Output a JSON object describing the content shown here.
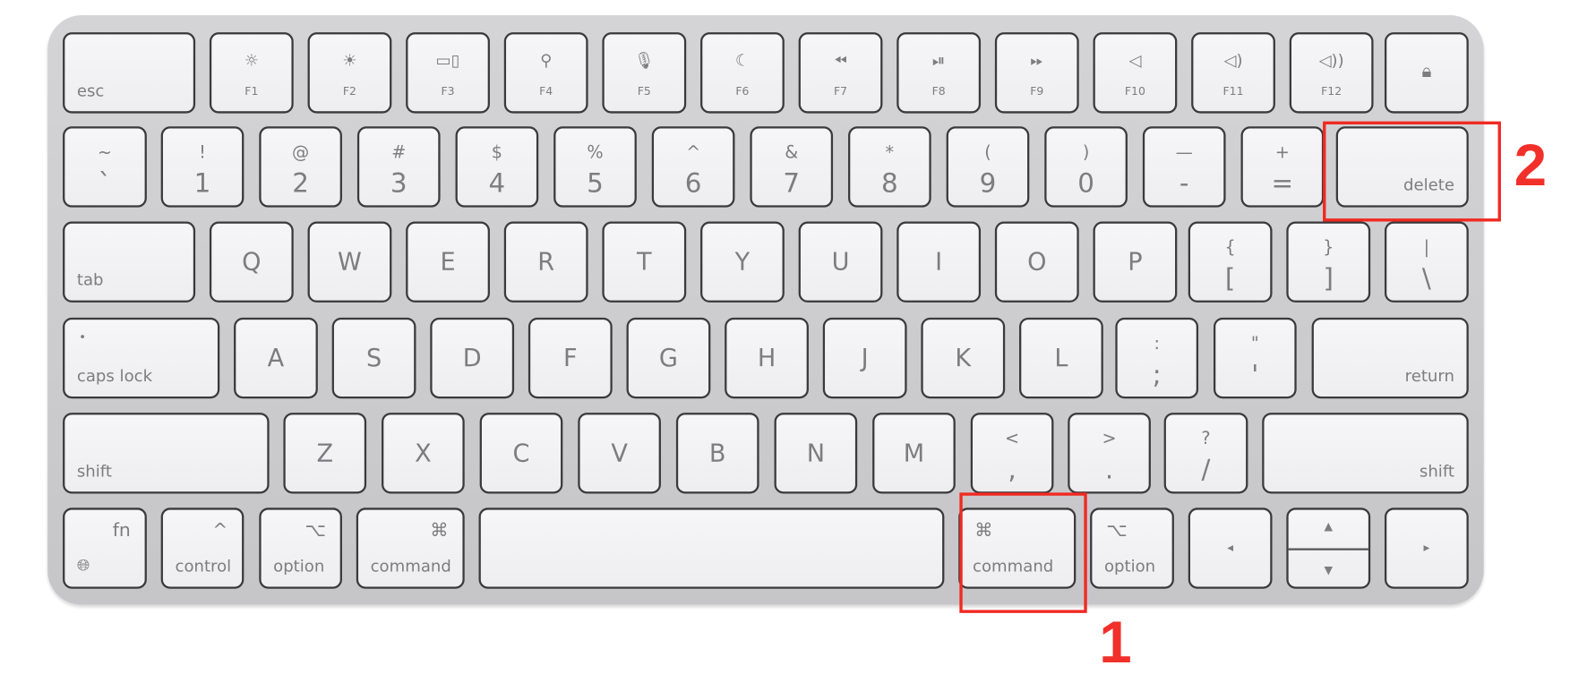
{
  "keyboard": {
    "rows": [
      [
        {
          "name": "esc",
          "label": "esc"
        },
        {
          "name": "f1",
          "icon": "brightness-down-icon",
          "glyph": "☼",
          "fn": "F1"
        },
        {
          "name": "f2",
          "icon": "brightness-up-icon",
          "glyph": "☀",
          "fn": "F2"
        },
        {
          "name": "f3",
          "icon": "mission-control-icon",
          "glyph": "▭▯",
          "fn": "F3"
        },
        {
          "name": "f4",
          "icon": "search-icon",
          "glyph": "⚲",
          "fn": "F4"
        },
        {
          "name": "f5",
          "icon": "microphone-icon",
          "glyph": "🎙︎",
          "fn": "F5"
        },
        {
          "name": "f6",
          "icon": "moon-icon",
          "glyph": "☾",
          "fn": "F6"
        },
        {
          "name": "f7",
          "icon": "rewind-icon",
          "glyph": "⏪︎",
          "fn": "F7"
        },
        {
          "name": "f8",
          "icon": "play-pause-icon",
          "glyph": "⏯︎",
          "fn": "F8"
        },
        {
          "name": "f9",
          "icon": "fast-forward-icon",
          "glyph": "⏩︎",
          "fn": "F9"
        },
        {
          "name": "f10",
          "icon": "mute-icon",
          "glyph": "◁",
          "fn": "F10"
        },
        {
          "name": "f11",
          "icon": "volume-down-icon",
          "glyph": "◁)",
          "fn": "F11"
        },
        {
          "name": "f12",
          "icon": "volume-up-icon",
          "glyph": "◁))",
          "fn": "F12"
        },
        {
          "name": "lock",
          "icon": "lock-icon",
          "glyph": "🔒︎"
        }
      ],
      [
        {
          "name": "tilde",
          "top": "~",
          "bottom": "`"
        },
        {
          "name": "1",
          "top": "!",
          "bottom": "1"
        },
        {
          "name": "2",
          "top": "@",
          "bottom": "2"
        },
        {
          "name": "3",
          "top": "#",
          "bottom": "3"
        },
        {
          "name": "4",
          "top": "$",
          "bottom": "4"
        },
        {
          "name": "5",
          "top": "%",
          "bottom": "5"
        },
        {
          "name": "6",
          "top": "^",
          "bottom": "6"
        },
        {
          "name": "7",
          "top": "&",
          "bottom": "7"
        },
        {
          "name": "8",
          "top": "*",
          "bottom": "8"
        },
        {
          "name": "9",
          "top": "(",
          "bottom": "9"
        },
        {
          "name": "0",
          "top": ")",
          "bottom": "0"
        },
        {
          "name": "minus",
          "top": "—",
          "bottom": "-"
        },
        {
          "name": "equals",
          "top": "+",
          "bottom": "="
        },
        {
          "name": "delete",
          "label": "delete"
        }
      ],
      [
        {
          "name": "tab",
          "label": "tab"
        },
        {
          "name": "q",
          "label": "Q"
        },
        {
          "name": "w",
          "label": "W"
        },
        {
          "name": "e",
          "label": "E"
        },
        {
          "name": "r",
          "label": "R"
        },
        {
          "name": "t",
          "label": "T"
        },
        {
          "name": "y",
          "label": "Y"
        },
        {
          "name": "u",
          "label": "U"
        },
        {
          "name": "i",
          "label": "I"
        },
        {
          "name": "o",
          "label": "O"
        },
        {
          "name": "p",
          "label": "P"
        },
        {
          "name": "bracket-left",
          "top": "{",
          "bottom": "["
        },
        {
          "name": "bracket-right",
          "top": "}",
          "bottom": "]"
        },
        {
          "name": "backslash",
          "top": "|",
          "bottom": "\\"
        }
      ],
      [
        {
          "name": "caps-lock",
          "label": "caps lock",
          "glyph": "•"
        },
        {
          "name": "a",
          "label": "A"
        },
        {
          "name": "s",
          "label": "S"
        },
        {
          "name": "d",
          "label": "D"
        },
        {
          "name": "f",
          "label": "F"
        },
        {
          "name": "g",
          "label": "G"
        },
        {
          "name": "h",
          "label": "H"
        },
        {
          "name": "j",
          "label": "J"
        },
        {
          "name": "k",
          "label": "K"
        },
        {
          "name": "l",
          "label": "L"
        },
        {
          "name": "semicolon",
          "top": ":",
          "bottom": ";"
        },
        {
          "name": "quote",
          "top": "\"",
          "bottom": "'"
        },
        {
          "name": "return",
          "label": "return"
        }
      ],
      [
        {
          "name": "shift-left",
          "label": "shift"
        },
        {
          "name": "z",
          "label": "Z"
        },
        {
          "name": "x",
          "label": "X"
        },
        {
          "name": "c",
          "label": "C"
        },
        {
          "name": "v",
          "label": "V"
        },
        {
          "name": "b",
          "label": "B"
        },
        {
          "name": "n",
          "label": "N"
        },
        {
          "name": "m",
          "label": "M"
        },
        {
          "name": "comma",
          "top": "<",
          "bottom": ","
        },
        {
          "name": "period",
          "top": ">",
          "bottom": "."
        },
        {
          "name": "slash",
          "top": "?",
          "bottom": "/"
        },
        {
          "name": "shift-right",
          "label": "shift"
        }
      ],
      [
        {
          "name": "fn",
          "label": "fn",
          "icon": "globe-icon",
          "glyph": "🌐︎"
        },
        {
          "name": "control",
          "label": "control",
          "glyph": "^"
        },
        {
          "name": "option-left",
          "label": "option",
          "glyph": "⌥"
        },
        {
          "name": "command-left",
          "label": "command",
          "glyph": "⌘"
        },
        {
          "name": "space",
          "label": ""
        },
        {
          "name": "command-right",
          "label": "command",
          "glyph": "⌘"
        },
        {
          "name": "option-right",
          "label": "option",
          "glyph": "⌥"
        },
        {
          "name": "arrow-left",
          "glyph": "◂"
        },
        {
          "name": "arrow-up-down",
          "top": "▲",
          "bottom": "▼"
        },
        {
          "name": "arrow-right",
          "glyph": "▸"
        }
      ]
    ]
  },
  "annotations": [
    {
      "label": "1",
      "target": "command-right",
      "color": "#f02a22"
    },
    {
      "label": "2",
      "target": "delete",
      "color": "#f02a22"
    }
  ]
}
